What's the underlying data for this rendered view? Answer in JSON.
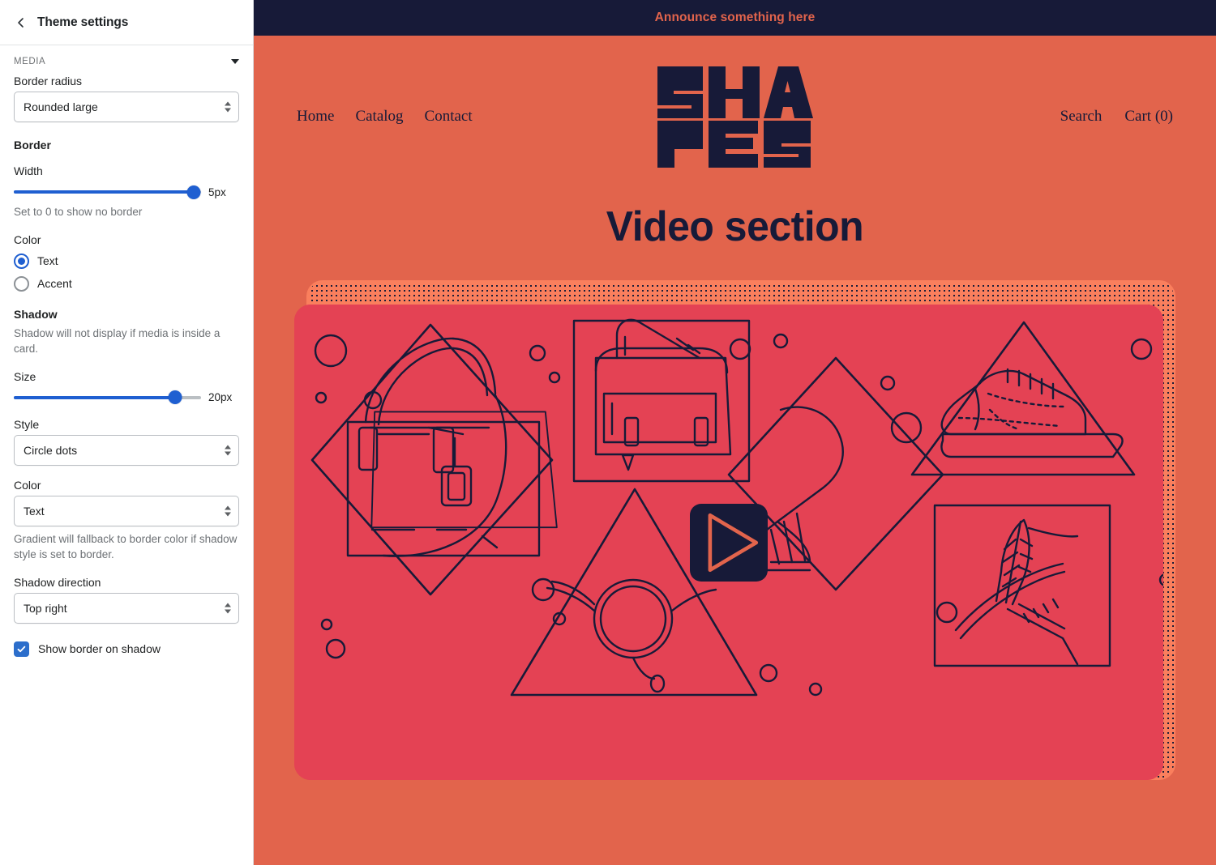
{
  "sidebar": {
    "title": "Theme settings",
    "back_icon": "chevron-left-icon",
    "section": {
      "label": "MEDIA",
      "collapse_icon": "caret-down-icon"
    },
    "border_radius": {
      "label": "Border radius",
      "value": "Rounded large"
    },
    "border": {
      "heading": "Border",
      "width_label": "Width",
      "width_value": "5px",
      "width_percent": 96,
      "width_hint": "Set to 0 to show no border",
      "color_label": "Color",
      "options": [
        {
          "label": "Text",
          "selected": true
        },
        {
          "label": "Accent",
          "selected": false
        }
      ]
    },
    "shadow": {
      "heading": "Shadow",
      "hint": "Shadow will not display if media is inside a card.",
      "size_label": "Size",
      "size_value": "20px",
      "size_percent": 86,
      "style_label": "Style",
      "style_value": "Circle dots",
      "color_label": "Color",
      "color_value": "Text",
      "color_hint": "Gradient will fallback to border color if shadow style is set to border.",
      "direction_label": "Shadow direction",
      "direction_value": "Top right",
      "show_border_label": "Show border on shadow",
      "show_border_checked": true
    }
  },
  "preview": {
    "announcement": "Announce something here",
    "logo_text": "SHAPES",
    "logo_line1": "SHA",
    "logo_line2": "PES",
    "nav": [
      {
        "label": "Home"
      },
      {
        "label": "Catalog"
      },
      {
        "label": "Contact"
      }
    ],
    "utility_nav": [
      {
        "label": "Search"
      },
      {
        "label": "Cart (0)"
      }
    ],
    "section_title": "Video section",
    "play_button_icon": "play-triangle-icon"
  },
  "colors": {
    "page_background": "#e2644c",
    "announcement_background": "#171a38",
    "announcement_text": "#e2644c",
    "text_dark": "#171a38",
    "media_background": "#e44254",
    "shadow_fill": "#fa7f5d",
    "shadow_dots": "#171a38",
    "accent_blue": "#1f5fd1",
    "checkbox_blue": "#2c6ecb"
  }
}
